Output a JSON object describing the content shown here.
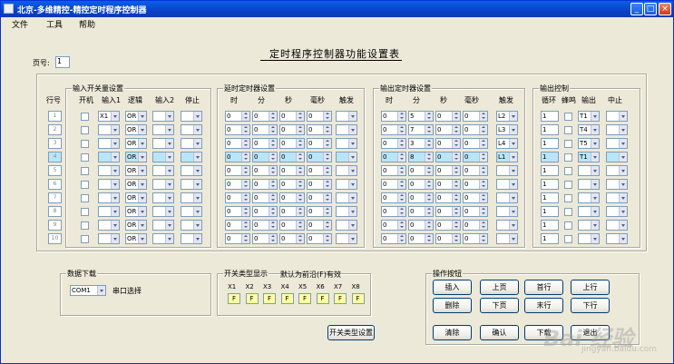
{
  "window": {
    "title": "北京-多维精控-精控定时程序控制器",
    "buttons": [
      "_",
      "□",
      "×"
    ]
  },
  "menu": [
    "文件",
    "工具",
    "帮助"
  ],
  "header": {
    "title": "定时程序控制器功能设置表"
  },
  "page": {
    "label": "页号:",
    "value": "1"
  },
  "row_header": "行号",
  "rows": [
    {
      "no": "1",
      "input1": "X1",
      "logic": "OR",
      "delay_trigger": "",
      "out_h": "0",
      "out_m": "5",
      "out_s": "0",
      "out_ms": "0",
      "out_trigger": "L2",
      "loop": "1",
      "output": "T1"
    },
    {
      "no": "2",
      "input1": "",
      "logic": "OR",
      "delay_trigger": "",
      "out_h": "0",
      "out_m": "7",
      "out_s": "0",
      "out_ms": "0",
      "out_trigger": "L3",
      "loop": "1",
      "output": "T4"
    },
    {
      "no": "3",
      "input1": "",
      "logic": "OR",
      "delay_trigger": "",
      "out_h": "0",
      "out_m": "3",
      "out_s": "0",
      "out_ms": "0",
      "out_trigger": "L4",
      "loop": "1",
      "output": "T5"
    },
    {
      "no": "4",
      "input1": "",
      "logic": "OR",
      "delay_trigger": "",
      "out_h": "0",
      "out_m": "8",
      "out_s": "0",
      "out_ms": "0",
      "out_trigger": "L1",
      "loop": "1",
      "output": "T1"
    },
    {
      "no": "5",
      "input1": "",
      "logic": "OR",
      "delay_trigger": "",
      "out_h": "0",
      "out_m": "0",
      "out_s": "0",
      "out_ms": "0",
      "out_trigger": "",
      "loop": "1",
      "output": ""
    },
    {
      "no": "6",
      "input1": "",
      "logic": "OR",
      "delay_trigger": "",
      "out_h": "0",
      "out_m": "0",
      "out_s": "0",
      "out_ms": "0",
      "out_trigger": "",
      "loop": "1",
      "output": ""
    },
    {
      "no": "7",
      "input1": "",
      "logic": "OR",
      "delay_trigger": "",
      "out_h": "0",
      "out_m": "0",
      "out_s": "0",
      "out_ms": "0",
      "out_trigger": "",
      "loop": "1",
      "output": ""
    },
    {
      "no": "8",
      "input1": "",
      "logic": "OR",
      "delay_trigger": "",
      "out_h": "0",
      "out_m": "0",
      "out_s": "0",
      "out_ms": "0",
      "out_trigger": "",
      "loop": "1",
      "output": ""
    },
    {
      "no": "9",
      "input1": "",
      "logic": "OR",
      "delay_trigger": "",
      "out_h": "0",
      "out_m": "0",
      "out_s": "0",
      "out_ms": "0",
      "out_trigger": "",
      "loop": "1",
      "output": ""
    },
    {
      "no": "10",
      "input1": "",
      "logic": "OR",
      "delay_trigger": "",
      "out_h": "0",
      "out_m": "0",
      "out_s": "0",
      "out_ms": "0",
      "out_trigger": "",
      "loop": "1",
      "output": ""
    }
  ],
  "selected_row_index": 3,
  "input_group": {
    "title": "输入开关量设置",
    "cols": [
      "开机",
      "输入1",
      "逻辑",
      "输入2",
      "停止"
    ]
  },
  "delay_group": {
    "title": "延时定时器设置",
    "cols": [
      "时",
      "分",
      "秒",
      "毫秒",
      "触发"
    ],
    "value": "0"
  },
  "output_timer_group": {
    "title": "输出定时器设置",
    "cols": [
      "时",
      "分",
      "秒",
      "毫秒",
      "触发"
    ]
  },
  "output_ctrl_group": {
    "title": "输出控制",
    "cols": [
      "循环",
      "蜂鸣",
      "输出",
      "中止"
    ]
  },
  "download": {
    "title": "数据下载",
    "port_value": "COM1",
    "port_label": "串口选择"
  },
  "switch_display": {
    "title": "开关类型显示",
    "note": "默认为前沿(F)有效",
    "labels": [
      "X1",
      "X2",
      "X3",
      "X4",
      "X5",
      "X6",
      "X7",
      "X8"
    ],
    "values": [
      "F",
      "F",
      "F",
      "F",
      "F",
      "F",
      "F",
      "F"
    ]
  },
  "switch_type_button": "开关类型设置",
  "ops": {
    "title": "操作按钮",
    "buttons": [
      "插入",
      "上页",
      "首行",
      "上行",
      "删除",
      "下页",
      "末行",
      "下行",
      "清除",
      "确认",
      "下载",
      "退出"
    ]
  },
  "watermark": {
    "main": "Bai 经验",
    "sub": "jingyan.baidu.com"
  },
  "colors": {
    "titlebar": "#0842c8",
    "window_bg": "#ece9d8",
    "highlight": "#b9e6f6",
    "switch_box": "#ffffa0"
  }
}
